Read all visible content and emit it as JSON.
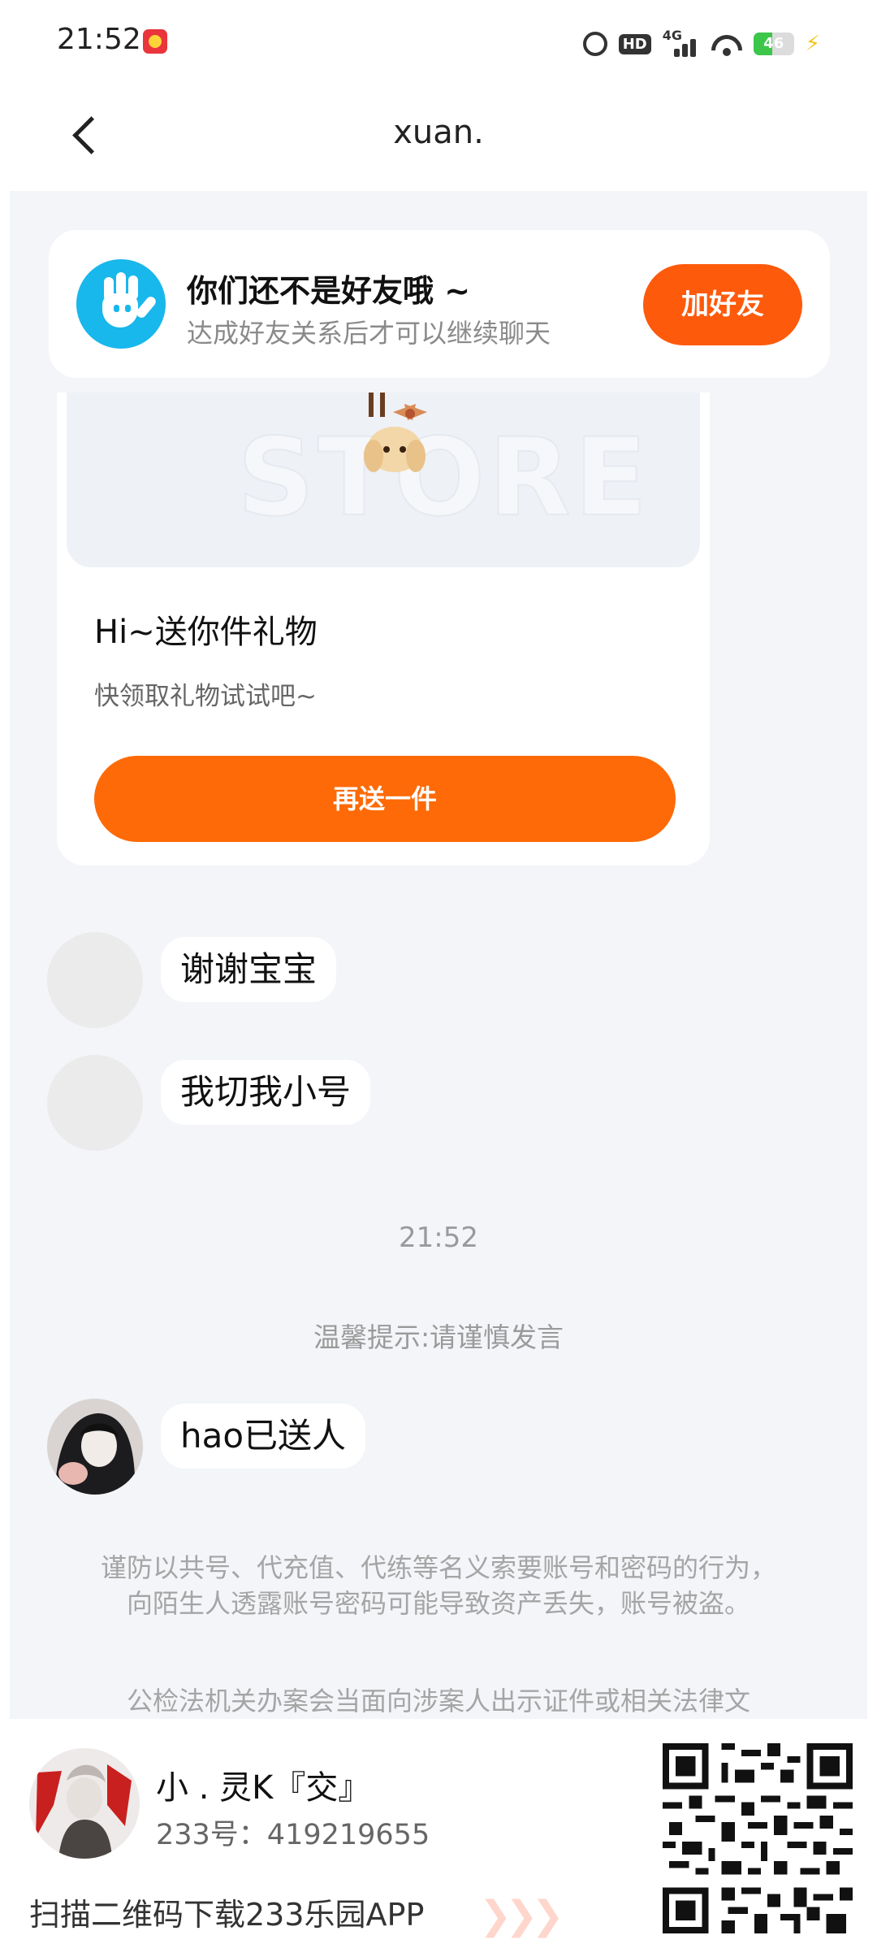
{
  "status_bar": {
    "time": "21:52",
    "network": "4G",
    "hd": "HD",
    "battery_level": "46"
  },
  "header": {
    "title": "xuan."
  },
  "friend_prompt": {
    "title": "你们还不是好友哦 ~",
    "subtitle": "达成好友关系后才可以继续聊天",
    "button": "加好友"
  },
  "gift_card": {
    "watermark": "STORE",
    "title": "Hi~送你件礼物",
    "subtitle": "快领取礼物试试吧~",
    "button": "再送一件"
  },
  "messages": [
    {
      "text": "谢谢宝宝"
    },
    {
      "text": "我切我小号"
    },
    {
      "text": "hao已送人"
    }
  ],
  "time_divider": "21:52",
  "tip": "温馨提示:请谨慎发言",
  "warnings": [
    "谨防以共号、代充值、代练等名义索要账号和密码的行为，向陌生人透露账号密码可能导致资产丢失，账号被盗。",
    "公检法机关办案会当面向涉案人出示证件或相关法律文"
  ],
  "promo": {
    "name": "小 . 灵K『交』",
    "id": "233号：419219655",
    "scan": "扫描二维码下载233乐园APP"
  },
  "colors": {
    "accent_orange": "#fe5a0c",
    "button_orange": "#fe6a07",
    "icon_blue": "#18b7ec",
    "panel_bg": "#f3f5f8"
  }
}
